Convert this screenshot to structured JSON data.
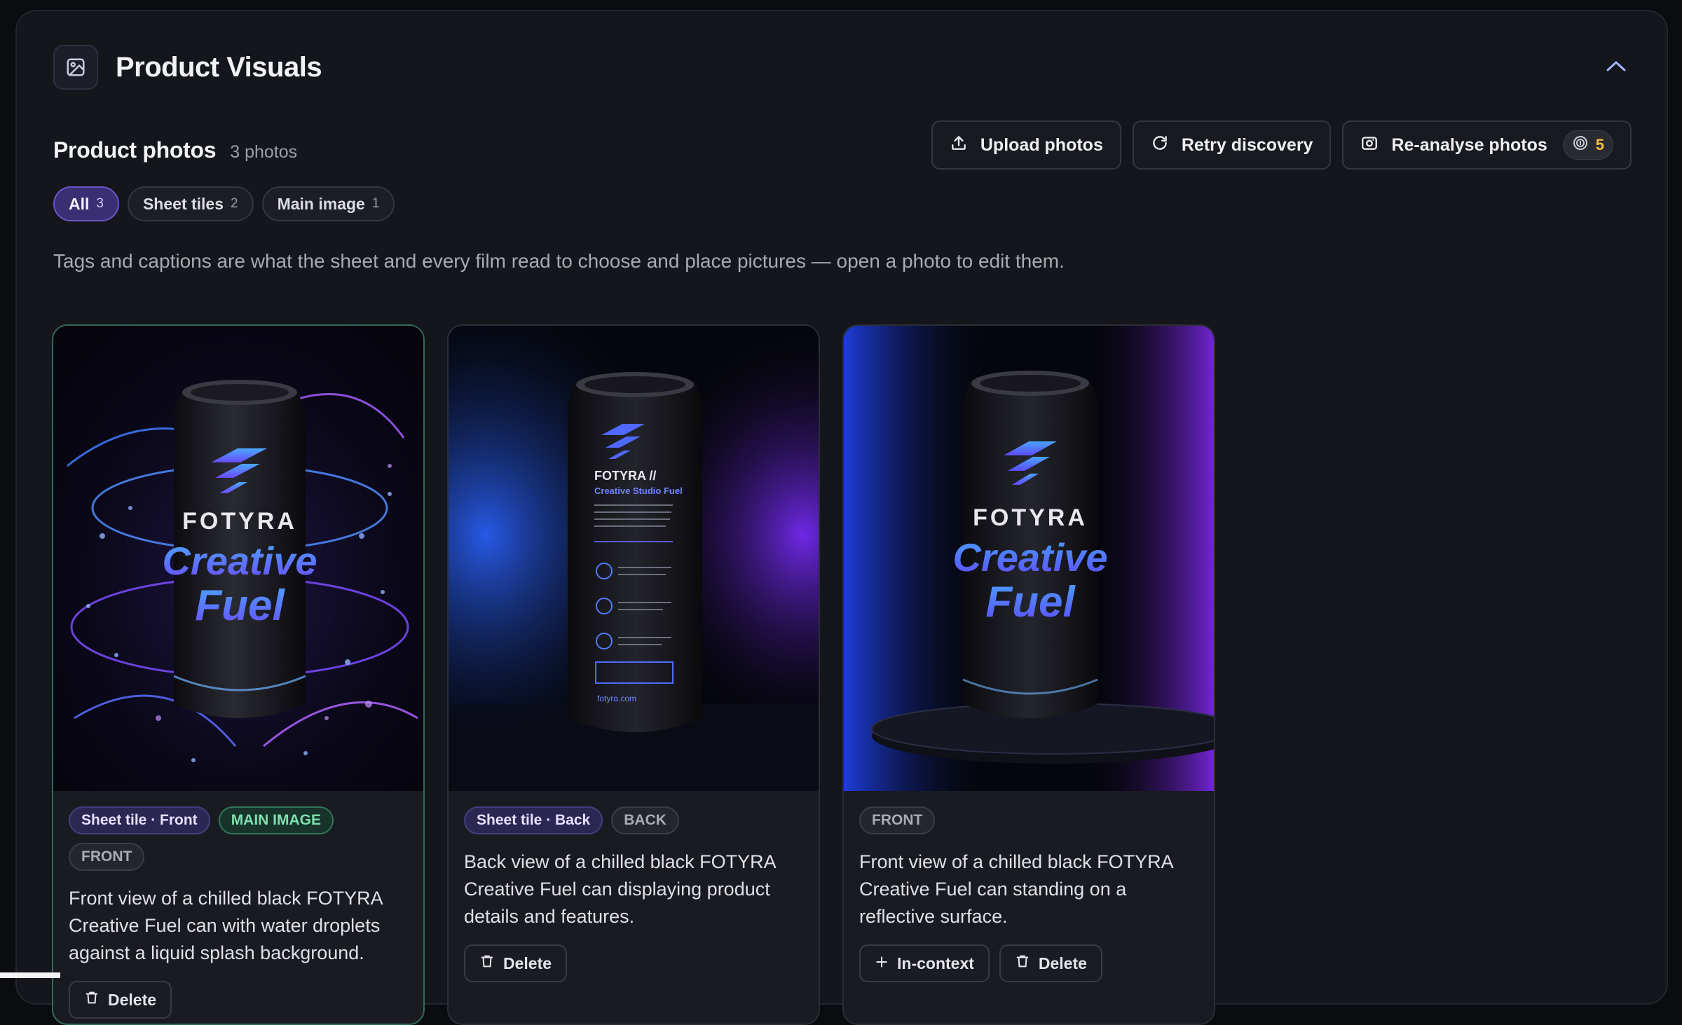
{
  "section": {
    "title": "Product Visuals",
    "icon": "image-icon",
    "collapse_icon": "chevron-up-icon"
  },
  "photos": {
    "title": "Product photos",
    "count_label": "3 photos"
  },
  "actions": {
    "upload_label": "Upload photos",
    "retry_label": "Retry discovery",
    "reanalyse_label": "Re-analyse photos",
    "credits": "5"
  },
  "filters": [
    {
      "label": "All",
      "count": "3",
      "active": true
    },
    {
      "label": "Sheet tiles",
      "count": "2",
      "active": false
    },
    {
      "label": "Main image",
      "count": "1",
      "active": false
    }
  ],
  "hint": "Tags and captions are what the sheet and every film read to choose and place pictures — open a photo to edit them.",
  "cards": [
    {
      "tags": [
        "Sheet tile · Front",
        "MAIN IMAGE",
        "FRONT"
      ],
      "caption": "Front view of a chilled black FOTYRA Creative Fuel can with water droplets against a liquid splash background.",
      "buttons": [
        "Delete"
      ],
      "can": {
        "brand": "FOTYRA",
        "line1": "Creative",
        "line2": "Fuel"
      }
    },
    {
      "tags": [
        "Sheet tile · Back",
        "BACK"
      ],
      "caption": "Back view of a chilled black FOTYRA Creative Fuel can displaying product details and features.",
      "buttons": [
        "Delete"
      ],
      "can": {
        "brand": "FOTYRA //",
        "line1": "Creative Studio Fuel",
        "line2": "fotyra.com"
      }
    },
    {
      "tags": [
        "FRONT"
      ],
      "caption": "Front view of a chilled black FOTYRA Creative Fuel can standing on a reflective surface.",
      "buttons": [
        "In-context",
        "Delete"
      ],
      "can": {
        "brand": "FOTYRA",
        "line1": "Creative",
        "line2": "Fuel"
      }
    }
  ],
  "colors": {
    "accent": "#6a55c8",
    "main_tag": "#7fe0ad",
    "credit": "#f1c044"
  }
}
